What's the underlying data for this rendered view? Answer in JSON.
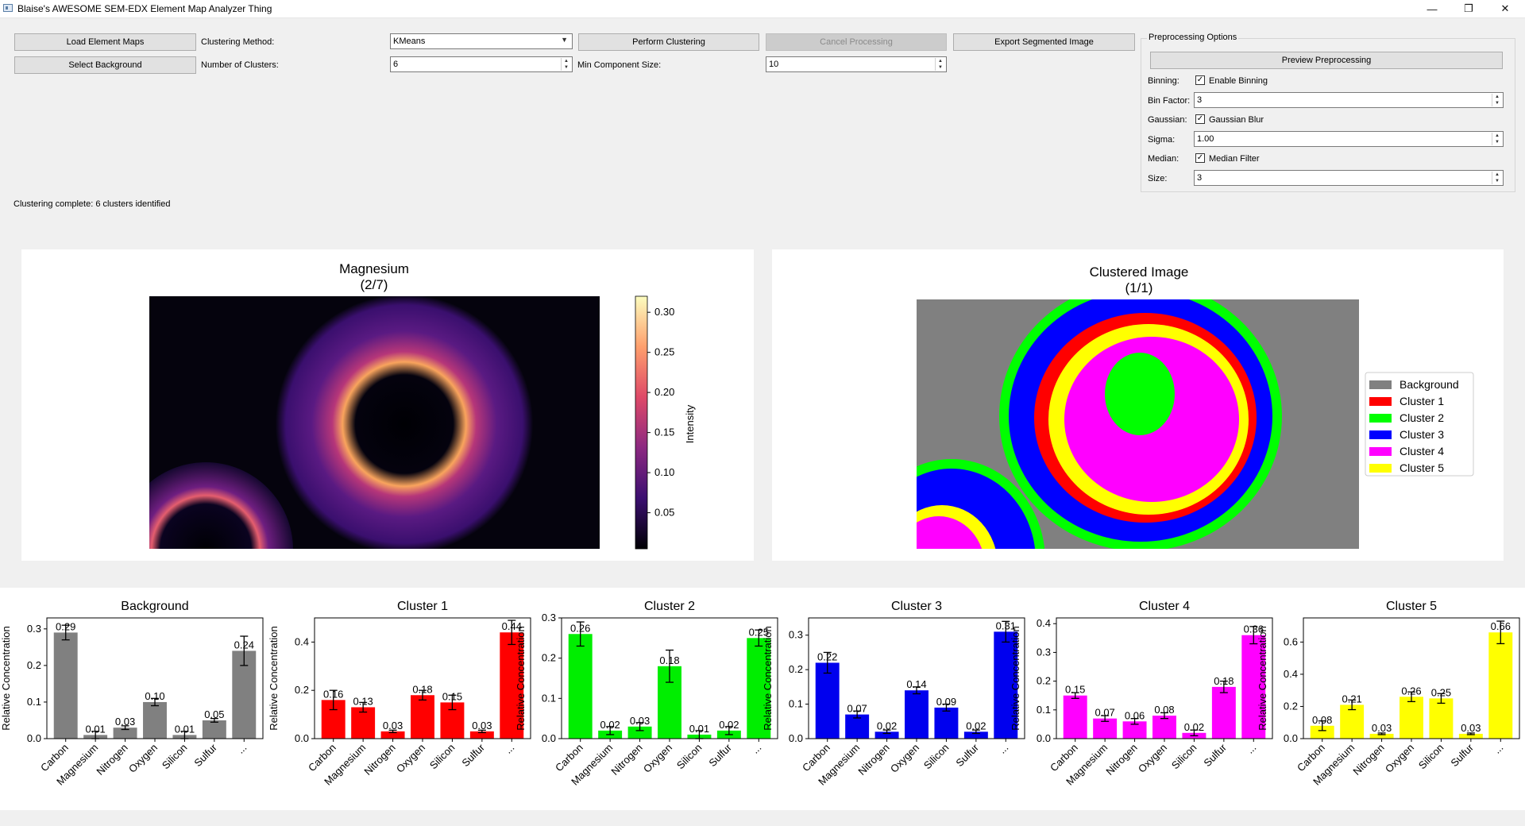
{
  "window": {
    "title": "Blaise's AWESOME SEM-EDX Element Map Analyzer Thing",
    "minimize": "—",
    "maximize": "❐",
    "close": "✕"
  },
  "toolbar": {
    "load_maps": "Load Element Maps",
    "select_background": "Select Background",
    "clustering_method_label": "Clustering Method:",
    "clustering_method_value": "KMeans",
    "num_clusters_label": "Number of Clusters:",
    "num_clusters_value": "6",
    "perform_clustering": "Perform Clustering",
    "min_component_label": "Min Component Size:",
    "min_component_value": "10",
    "cancel_processing": "Cancel Processing",
    "export_segmented": "Export Segmented Image"
  },
  "preprocessing": {
    "group_title": "Preprocessing Options",
    "preview_button": "Preview Preprocessing",
    "binning_label": "Binning:",
    "binning_check": "Enable Binning",
    "bin_factor_label": "Bin Factor:",
    "bin_factor_value": "3",
    "gaussian_label": "Gaussian:",
    "gaussian_check": "Gaussian Blur",
    "sigma_label": "Sigma:",
    "sigma_value": "1.00",
    "median_label": "Median:",
    "median_check": "Median Filter",
    "size_label": "Size:",
    "size_value": "3",
    "checkmark": "✓"
  },
  "status": "Clustering complete: 6 clusters identified",
  "element_map": {
    "title": "Magnesium",
    "subtitle": "(2/7)",
    "colorbar_label": "Intensity",
    "colorbar_ticks": [
      "0.30",
      "0.25",
      "0.20",
      "0.15",
      "0.10",
      "0.05"
    ]
  },
  "clustered": {
    "title": "Clustered Image",
    "subtitle": "(1/1)",
    "legend": [
      {
        "name": "Background",
        "color": "#808080"
      },
      {
        "name": "Cluster 1",
        "color": "#ff0000"
      },
      {
        "name": "Cluster 2",
        "color": "#00ff00"
      },
      {
        "name": "Cluster 3",
        "color": "#0000ff"
      },
      {
        "name": "Cluster 4",
        "color": "#ff00ff"
      },
      {
        "name": "Cluster 5",
        "color": "#ffff00"
      }
    ]
  },
  "chart_data": [
    {
      "type": "bar",
      "title": "Background",
      "ylabel": "Relative Concentration",
      "color": "#808080",
      "categories": [
        "Carbon",
        "Magnesium",
        "Nitrogen",
        "Oxygen",
        "Silicon",
        "Sulfur",
        "..."
      ],
      "values": [
        0.29,
        0.01,
        0.03,
        0.1,
        0.01,
        0.05,
        0.24
      ],
      "errors": [
        0.02,
        0.01,
        0.005,
        0.01,
        0.01,
        0.005,
        0.04
      ],
      "ylim": [
        0,
        0.33
      ],
      "yticks": [
        "0.0",
        "0.1",
        "0.2",
        "0.3"
      ],
      "ytick_values": [
        0,
        0.1,
        0.2,
        0.3
      ]
    },
    {
      "type": "bar",
      "title": "Cluster 1",
      "ylabel": "Relative Concentration",
      "color": "#ff0000",
      "categories": [
        "Carbon",
        "Magnesium",
        "Nitrogen",
        "Oxygen",
        "Silicon",
        "Sulfur",
        "..."
      ],
      "values": [
        0.16,
        0.13,
        0.03,
        0.18,
        0.15,
        0.03,
        0.44
      ],
      "errors": [
        0.04,
        0.02,
        0.005,
        0.02,
        0.03,
        0.005,
        0.05
      ],
      "ylim": [
        0,
        0.5
      ],
      "yticks": [
        "0.0",
        "0.2",
        "0.4"
      ],
      "ytick_values": [
        0,
        0.2,
        0.4
      ]
    },
    {
      "type": "bar",
      "title": "Cluster 2",
      "ylabel": "Relative Concentration",
      "color": "#00ee00",
      "categories": [
        "Carbon",
        "Magnesium",
        "Nitrogen",
        "Oxygen",
        "Silicon",
        "Sulfur",
        "..."
      ],
      "values": [
        0.26,
        0.02,
        0.03,
        0.18,
        0.01,
        0.02,
        0.25
      ],
      "errors": [
        0.03,
        0.01,
        0.01,
        0.04,
        0.01,
        0.01,
        0.02
      ],
      "ylim": [
        0,
        0.3
      ],
      "yticks": [
        "0.0",
        "0.1",
        "0.2",
        "0.3"
      ],
      "ytick_values": [
        0,
        0.1,
        0.2,
        0.3
      ]
    },
    {
      "type": "bar",
      "title": "Cluster 3",
      "ylabel": "Relative Concentration",
      "color": "#0000ee",
      "categories": [
        "Carbon",
        "Magnesium",
        "Nitrogen",
        "Oxygen",
        "Silicon",
        "Sulfur",
        "..."
      ],
      "values": [
        0.22,
        0.07,
        0.02,
        0.14,
        0.09,
        0.02,
        0.31
      ],
      "errors": [
        0.03,
        0.01,
        0.005,
        0.01,
        0.01,
        0.005,
        0.03
      ],
      "ylim": [
        0,
        0.35
      ],
      "yticks": [
        "0.0",
        "0.1",
        "0.2",
        "0.3"
      ],
      "ytick_values": [
        0,
        0.1,
        0.2,
        0.3
      ]
    },
    {
      "type": "bar",
      "title": "Cluster 4",
      "ylabel": "Relative Concentration",
      "color": "#ff00ff",
      "categories": [
        "Carbon",
        "Magnesium",
        "Nitrogen",
        "Oxygen",
        "Silicon",
        "Sulfur",
        "..."
      ],
      "values": [
        0.15,
        0.07,
        0.06,
        0.08,
        0.02,
        0.18,
        0.36
      ],
      "errors": [
        0.01,
        0.01,
        0.01,
        0.01,
        0.01,
        0.02,
        0.03
      ],
      "ylim": [
        0,
        0.42
      ],
      "yticks": [
        "0.0",
        "0.1",
        "0.2",
        "0.3",
        "0.4"
      ],
      "ytick_values": [
        0,
        0.1,
        0.2,
        0.3,
        0.4
      ]
    },
    {
      "type": "bar",
      "title": "Cluster 5",
      "ylabel": "Relative Concentration",
      "color": "#ffff00",
      "categories": [
        "Carbon",
        "Magnesium",
        "Nitrogen",
        "Oxygen",
        "Silicon",
        "Sulfur",
        "..."
      ],
      "values": [
        0.08,
        0.21,
        0.03,
        0.26,
        0.25,
        0.03,
        0.66
      ],
      "errors": [
        0.03,
        0.03,
        0.005,
        0.03,
        0.03,
        0.005,
        0.07
      ],
      "ylim": [
        0,
        0.75
      ],
      "yticks": [
        "0.0",
        "0.2",
        "0.4",
        "0.6"
      ],
      "ytick_values": [
        0,
        0.2,
        0.4,
        0.6
      ]
    }
  ]
}
